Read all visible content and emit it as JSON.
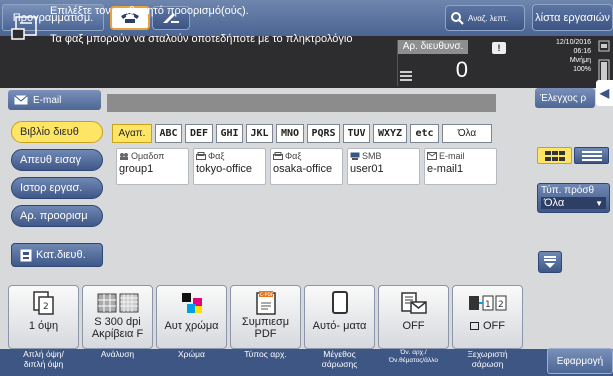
{
  "topbar": {
    "program_label": "Προγραμματισμ.",
    "search_label": "Αναζ. λεπτ.",
    "job_list_label": "λίστα εργασιών"
  },
  "message": {
    "line1": "Επιλέξτε τον επιθυμητό προορισμό(ούς).",
    "line2": "Τα φαξ μπορούν να σταλούν οποτεδήποτε με το πληκτρολόγιο",
    "destinations_label": "Αρ. διευθυνσ.",
    "destinations_count": "0",
    "warning": "!",
    "date": "12/10/2016",
    "time": "06:16",
    "memory_label": "Μνήμη",
    "memory_value": "100%"
  },
  "address_row": {
    "email_label": "E-mail",
    "check_label": "Έλεγχος ρ"
  },
  "side_tabs": [
    {
      "label": "Βιβλίο διευθ",
      "active": true
    },
    {
      "label": "Απευθ εισαγ",
      "active": false
    },
    {
      "label": "Ιστορ εργασ.",
      "active": false
    },
    {
      "label": "Αρ. προορισμ",
      "active": false
    },
    {
      "label": "Κατ.διευθ.",
      "active": false
    }
  ],
  "letters": [
    "Αγαπ.",
    "ABC",
    "DEF",
    "GHI",
    "JKL",
    "MNO",
    "PQRS",
    "TUV",
    "WXYZ",
    "etc",
    "Όλα"
  ],
  "entries": [
    {
      "type": "Ομαδοπ",
      "name": "group1",
      "icon": "group-icon"
    },
    {
      "type": "Φαξ",
      "name": "tokyo-office",
      "icon": "fax-icon"
    },
    {
      "type": "Φαξ",
      "name": "osaka-office",
      "icon": "fax-icon"
    },
    {
      "type": "SMB",
      "name": "user01",
      "icon": "smb-icon"
    },
    {
      "type": "E-mail",
      "name": "e-mail1",
      "icon": "email-icon"
    }
  ],
  "type_filter": {
    "label": "Τύπ. πρόσθ",
    "value": "Όλα"
  },
  "settings": [
    {
      "value": "1 όψη",
      "label1": "Απλή όψη/",
      "label2": "διπλή όψη"
    },
    {
      "value": "S 300 dpi",
      "value2": "Ακρίβεια F",
      "label1": "Ανάλυση",
      "label2": ""
    },
    {
      "value": "Αυτ χρώμα",
      "label1": "Χρώμα",
      "label2": ""
    },
    {
      "value": "Συμπιεσμ",
      "value2": "PDF",
      "label1": "Τύπος αρχ.",
      "label2": ""
    },
    {
      "value": "Αυτό- ματα",
      "label1": "Μέγεθος",
      "label2": "σάρωσης"
    },
    {
      "value": "OFF",
      "label1": "Όν. αρχ./",
      "label2": "Όν.θέματος/άλλο"
    },
    {
      "value": "OFF",
      "label1": "Ξεχωριστή",
      "label2": "σάρωση"
    }
  ],
  "start_label": "Εφαρμογή",
  "colors": {
    "accent": "#ffe566",
    "topbar": "#4b6493",
    "dark_panel": "#2d2d30"
  }
}
